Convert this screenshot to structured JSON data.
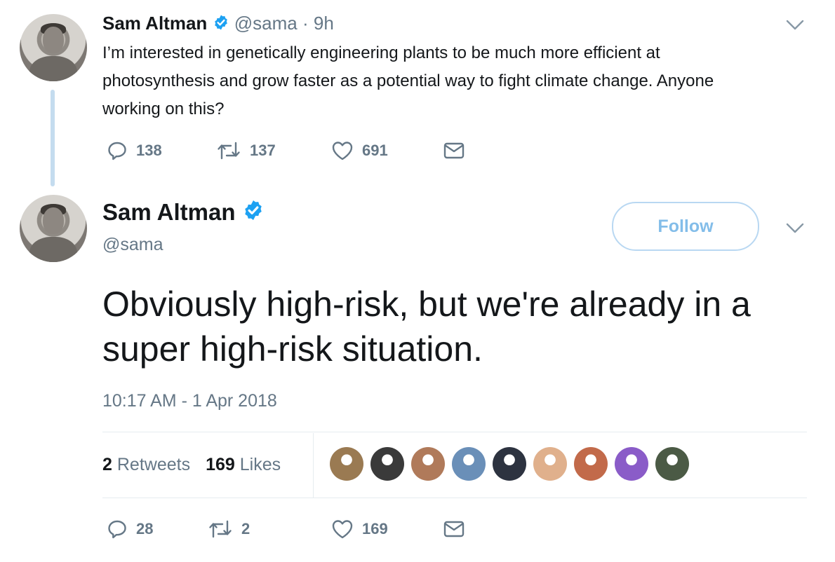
{
  "thread_tweet": {
    "author_name": "Sam Altman",
    "handle": "@sama",
    "separator": "·",
    "time_ago": "9h",
    "text": "I’m interested in genetically engineering plants to be much more efficient at photosynthesis and grow faster as a potential way to fight climate change. Anyone working on this?",
    "replies": "138",
    "retweets": "137",
    "likes": "691"
  },
  "main_tweet": {
    "author_name": "Sam Altman",
    "handle": "@sama",
    "follow_label": "Follow",
    "text": "Obviously high-risk, but we're already in a super high-risk situation.",
    "timestamp": "10:17 AM - 1 Apr 2018",
    "stats": {
      "retweets_count": "2",
      "retweets_label": "Retweets",
      "likes_count": "169",
      "likes_label": "Likes"
    },
    "replies": "28",
    "retweets": "2",
    "likes": "169"
  },
  "likers": [
    {
      "name": "liker-1",
      "color": "#9a7a52"
    },
    {
      "name": "liker-2",
      "color": "#3a3a3a"
    },
    {
      "name": "liker-3",
      "color": "#b07a5a"
    },
    {
      "name": "liker-4",
      "color": "#6a8fb8"
    },
    {
      "name": "liker-5",
      "color": "#2d3340"
    },
    {
      "name": "liker-6",
      "color": "#e0b08c"
    },
    {
      "name": "liker-7",
      "color": "#c26a4a"
    },
    {
      "name": "liker-8",
      "color": "#8a5cc8"
    },
    {
      "name": "liker-9",
      "color": "#4b5a45"
    }
  ],
  "colors": {
    "verified": "#1da1f2",
    "icon_gray": "#657786",
    "follow_border": "#b9d8f2"
  }
}
